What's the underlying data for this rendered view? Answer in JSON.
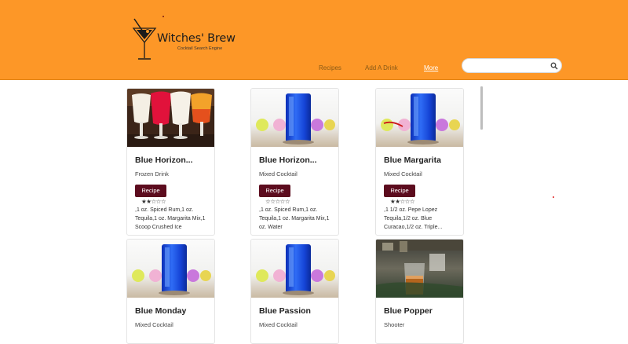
{
  "app": {
    "title": "Witches' Brew",
    "subtitle": "Cocktail Search Engine"
  },
  "nav": {
    "recipes": "Recipes",
    "add_drink": "Add A Drink",
    "more": "More"
  },
  "search": {
    "placeholder": "",
    "value": ""
  },
  "colors": {
    "header": "#fd9727",
    "recipe_button": "#5c0c1e",
    "more_link": "#ffffff"
  },
  "cards": [
    {
      "name": "Blue Horizon...",
      "type": "Frozen Drink",
      "button": "Recipe",
      "rating": 2,
      "stars": "★★☆☆☆",
      "ingredients": ",1 oz. Spiced Rum,1 oz. Tequila,1 oz. Margarita Mix,1 Scoop Crushed Ice",
      "image": "frozen-drinks-photo"
    },
    {
      "name": "Blue Horizon...",
      "type": "Mixed Cocktail",
      "button": "Recipe",
      "rating": 0,
      "stars": "☆☆☆☆☆",
      "ingredients": ",1 oz. Spiced Rum,1 oz. Tequila,1 oz. Margarita Mix,1 oz. Water",
      "image": "blue-cocktail-photo"
    },
    {
      "name": "Blue Margarita",
      "type": "Mixed Cocktail",
      "button": "Recipe",
      "rating": 2,
      "stars": "★★☆☆☆",
      "ingredients": ",1 1/2 oz. Pepe Lopez Tequila,1/2 oz. Blue Curacao,1/2 oz. Triple...",
      "image": "blue-cocktail-photo"
    },
    {
      "name": "Blue Monday",
      "type": "Mixed Cocktail",
      "image": "blue-cocktail-photo"
    },
    {
      "name": "Blue Passion",
      "type": "Mixed Cocktail",
      "image": "blue-cocktail-photo"
    },
    {
      "name": "Blue Popper",
      "type": "Shooter",
      "image": "shot-glass-photo"
    }
  ]
}
